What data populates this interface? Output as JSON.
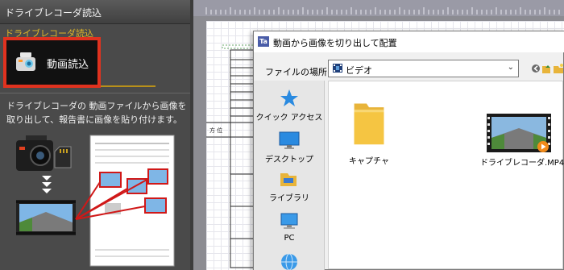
{
  "left_panel": {
    "header_title": "ドライブレコーダ読込",
    "section_label": "ドライブレコーダ読込",
    "video_button_label": "動画読込",
    "description": "ドライブレコーダの 動画ファイルから画像を取り出して、報告書に画像を貼り付けます。"
  },
  "document": {
    "form_label": "方 位"
  },
  "dialog": {
    "title": "動画から画像を切り出して配置",
    "app_icon_text": "Ta",
    "location_label": "ファイルの場所(I):",
    "location_value": "ビデオ",
    "places": [
      {
        "label": "クイック アクセス",
        "icon": "star-icon"
      },
      {
        "label": "デスクトップ",
        "icon": "desktop-icon"
      },
      {
        "label": "ライブラリ",
        "icon": "library-icon"
      },
      {
        "label": "PC",
        "icon": "pc-icon"
      },
      {
        "label": "",
        "icon": "network-icon"
      }
    ],
    "files": [
      {
        "name": "キャプチャ",
        "type": "folder"
      },
      {
        "name": "ドライブレコーダ.MP4",
        "type": "video"
      }
    ]
  },
  "colors": {
    "highlight_red": "#e0321f",
    "section_gold": "#e0b628",
    "panel_bg": "#4a4a4a",
    "folder_yellow": "#f5c542"
  }
}
